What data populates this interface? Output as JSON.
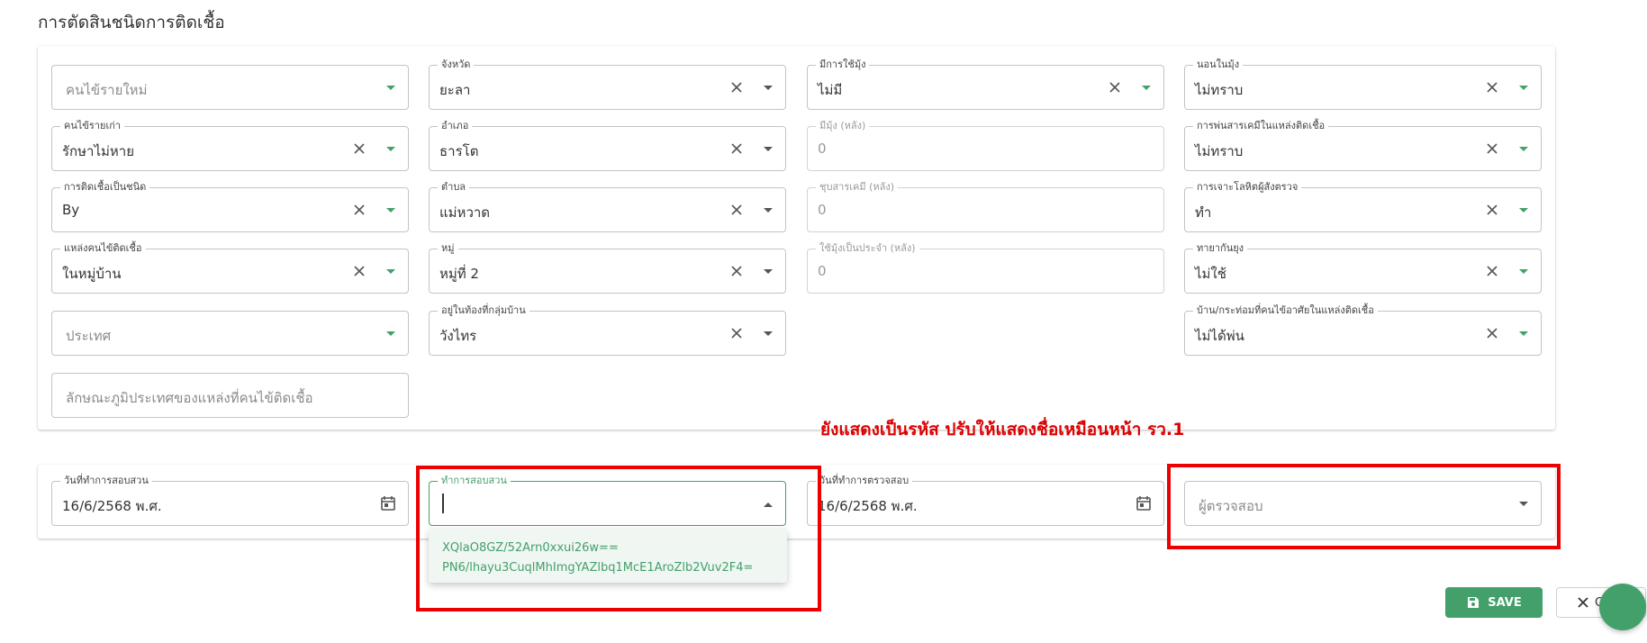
{
  "page_title": "การตัดสินชนิดการติดเชื้อ",
  "fields": {
    "new_patient": {
      "placeholder": "คนไข้รายใหม่"
    },
    "old_patient": {
      "label": "คนไข้รายเก่า",
      "value": "รักษาไม่หาย"
    },
    "infection_type": {
      "label": "การติดเชื้อเป็นชนิด",
      "value": "By"
    },
    "infection_source": {
      "label": "แหล่งคนไข้ติดเชื้อ",
      "value": "ในหมู่บ้าน"
    },
    "country": {
      "placeholder": "ประเทศ"
    },
    "terrain": {
      "placeholder": "ลักษณะภูมิประเทศของแหล่งที่คนไข้ติดเชื้อ"
    },
    "province": {
      "label": "จังหวัด",
      "value": "ยะลา"
    },
    "district": {
      "label": "อำเภอ",
      "value": "ธารโต"
    },
    "subdistrict": {
      "label": "ตำบล",
      "value": "แม่หวาด"
    },
    "village": {
      "label": "หมู่",
      "value": "หมู่ที่ 2"
    },
    "village_area": {
      "label": "อยู่ในท้องที่กลุ่มบ้าน",
      "value": "วังไทร"
    },
    "net_use": {
      "label": "มีการใช้มุ้ง",
      "value": "ไม่มี"
    },
    "net_count": {
      "label": "มีมุ้ง (หลัง)",
      "value": "0"
    },
    "net_chem": {
      "label": "ชุบสารเคมี (หลัง)",
      "value": "0"
    },
    "net_regular": {
      "label": "ใช้มุ้งเป็นประจำ (หลัง)",
      "value": "0"
    },
    "sleep_in_net": {
      "label": "นอนในมุ้ง",
      "value": "ไม่ทราบ"
    },
    "chem_spray": {
      "label": "การพ่นสารเคมีในแหล่งติดเชื้อ",
      "value": "ไม่ทราบ"
    },
    "blood_test": {
      "label": "การเจาะโลหิตผู้สังตรวจ",
      "value": "ทำ"
    },
    "repellent": {
      "label": "ทายากันยุง",
      "value": "ไม่ใช้"
    },
    "house_hut": {
      "label": "บ้าน/กระท่อมที่คนไข้อาศัยในแหล่งติดเชื้อ",
      "value": "ไม่ได้พ่น"
    }
  },
  "investigation": {
    "date": {
      "label": "วันที่ทำการสอบสวน",
      "value": "16/6/2568 พ.ศ."
    },
    "investigator": {
      "label": "ทำการสอบสวน",
      "value": ""
    },
    "check_date": {
      "label": "วันที่ทำการตรวจสอบ",
      "value": "16/6/2568 พ.ศ."
    },
    "checker": {
      "placeholder": "ผู้ตรวจสอบ"
    }
  },
  "dropdown_options": [
    "XQlaO8GZ/52Arn0xxui26w==",
    "PN6/lhayu3CuqlMhImgYAZlbq1McE1AroZlb2Vuv2F4="
  ],
  "annotation": "ยังแสดงเป็นรหัส ปรับให้แสดงชื่อเหมือนหน้า รว.1",
  "buttons": {
    "save": "SAVE",
    "close": "C"
  },
  "colors": {
    "accent": "#43a06b",
    "annotation": "#ee0000"
  }
}
